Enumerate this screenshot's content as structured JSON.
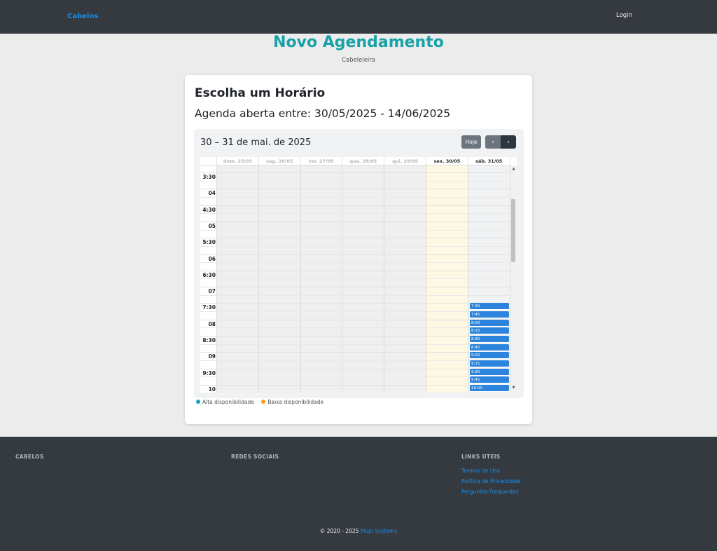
{
  "navbar": {
    "brand": "Cabelos",
    "login": "Login"
  },
  "header": {
    "title": "Novo Agendamento",
    "subtitle": "Cabeleleira"
  },
  "card": {
    "title": "Escolha um Horário",
    "range_text": "Agenda aberta entre: 30/05/2025 - 14/06/2025"
  },
  "calendar": {
    "title": "30 – 31 de mai. de 2025",
    "today_label": "Hoje",
    "days": [
      {
        "label": "dom. 25/05",
        "status": "past"
      },
      {
        "label": "seg. 26/05",
        "status": "past"
      },
      {
        "label": "ter. 27/05",
        "status": "past"
      },
      {
        "label": "qua. 28/05",
        "status": "past"
      },
      {
        "label": "qui. 29/05",
        "status": "past"
      },
      {
        "label": "sex. 30/05",
        "status": "today"
      },
      {
        "label": "sáb. 31/05",
        "status": "open"
      }
    ],
    "time_labels": [
      "3:30",
      "04",
      "4:30",
      "05",
      "5:30",
      "06",
      "6:30",
      "07",
      "7:30",
      "08",
      "8:30",
      "09",
      "9:30",
      "10"
    ],
    "events": [
      "7:30",
      "7:45",
      "8:00",
      "8:15",
      "8:30",
      "8:45",
      "9:00",
      "9:15",
      "9:30",
      "9:45",
      "10:00"
    ],
    "colors": {
      "today_bg": "#fcf8e3",
      "event": "#2c84dd"
    }
  },
  "legend": [
    {
      "label": "Alta disponibilidade",
      "color": "#17a2b8"
    },
    {
      "label": "Baixa disponibilidade",
      "color": "#fd9c12"
    }
  ],
  "footer": {
    "col1_title": "CABELOS",
    "col2_title": "REDES SOCIAIS",
    "col3_title": "LINKS ÚTEIS",
    "links": [
      "Termos de Uso",
      "Política de Privacidade",
      "Perguntas Frequentes"
    ],
    "copyright": "© 2020 - 2025",
    "company": "Mupi Systems"
  }
}
